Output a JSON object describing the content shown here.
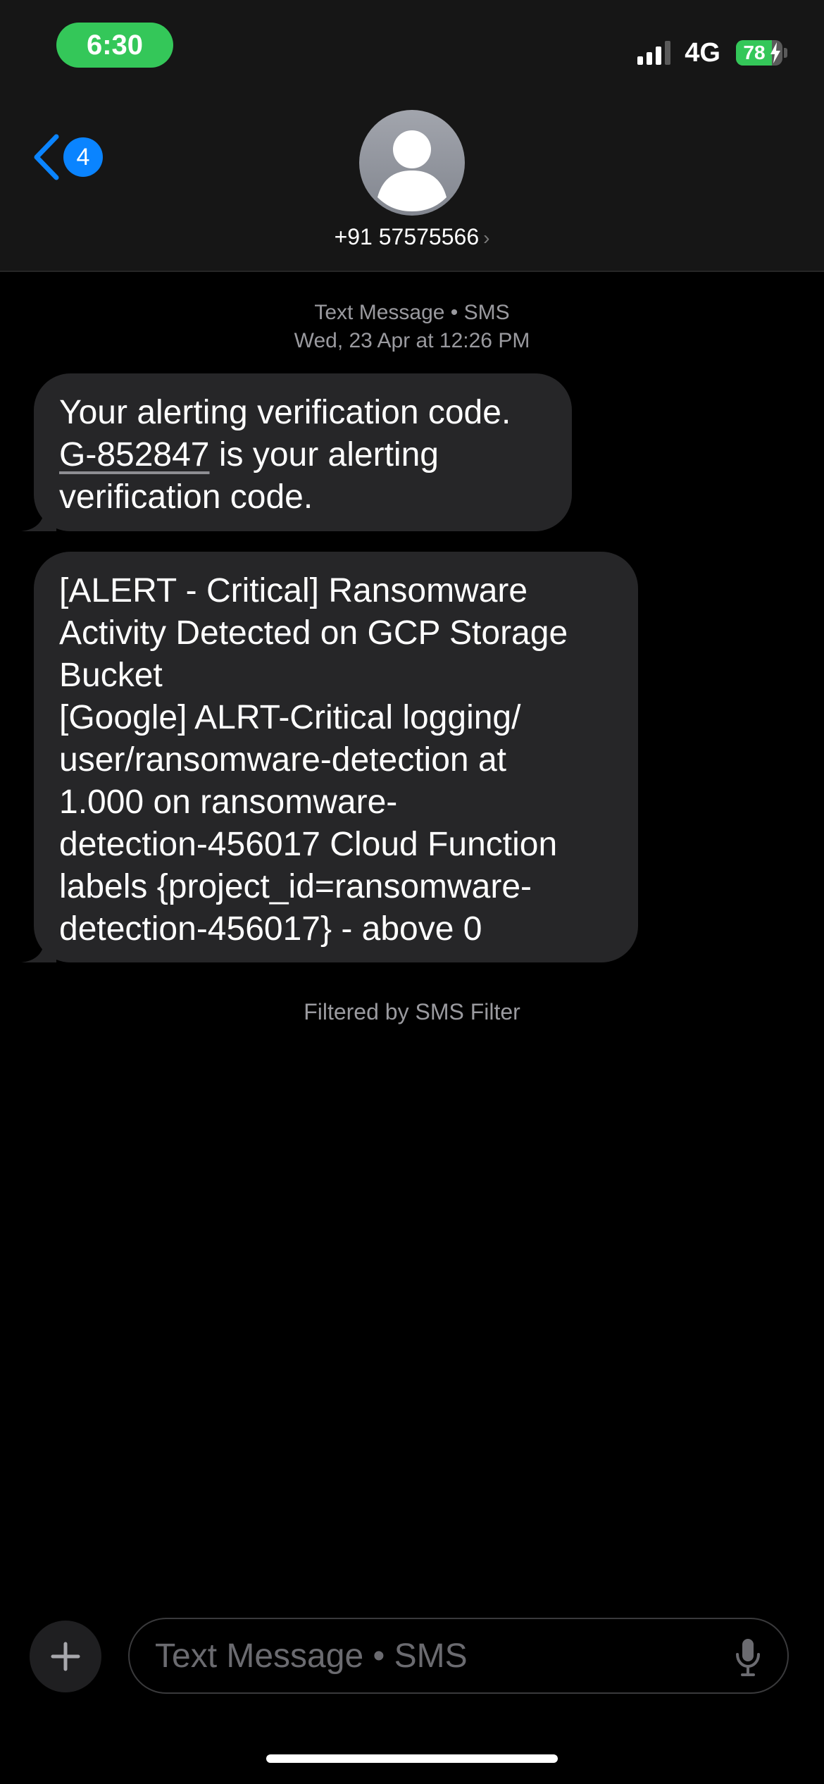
{
  "status_bar": {
    "time": "6:30",
    "network": "4G",
    "battery_level": "78",
    "battery_fraction": 0.78,
    "signal_bars": 3,
    "signal_total": 4,
    "accent_color": "#34c759"
  },
  "nav": {
    "back_badge": "4",
    "contact_name": "+91 57575566",
    "contact_chevron": "›",
    "back_icon": "chevron-left-icon",
    "avatar_icon": "person-icon"
  },
  "conversation": {
    "service_label": "Text Message • SMS",
    "timestamp": "Wed, 23 Apr at 12:26 PM",
    "messages": [
      {
        "code": "G-852847",
        "line1": "Your alerting verification code.",
        "after_code": " is your alerting",
        "line3": "verification code."
      },
      {
        "text": "[ALERT - Critical] Ransomware\nActivity Detected on GCP Storage\nBucket\n[Google] ALRT-Critical logging/\nuser/ransomware-detection at\n1.000 on ransomware-\ndetection-456017 Cloud Function\nlabels {project_id=ransomware-\ndetection-456017} - above 0"
      }
    ],
    "filter_note": "Filtered by SMS Filter"
  },
  "composer": {
    "placeholder": "Text Message • SMS",
    "plus_icon": "plus-icon",
    "mic_icon": "microphone-icon"
  },
  "colors": {
    "bubble": "#262628",
    "link_blue": "#0a84ff",
    "background": "#000000"
  }
}
